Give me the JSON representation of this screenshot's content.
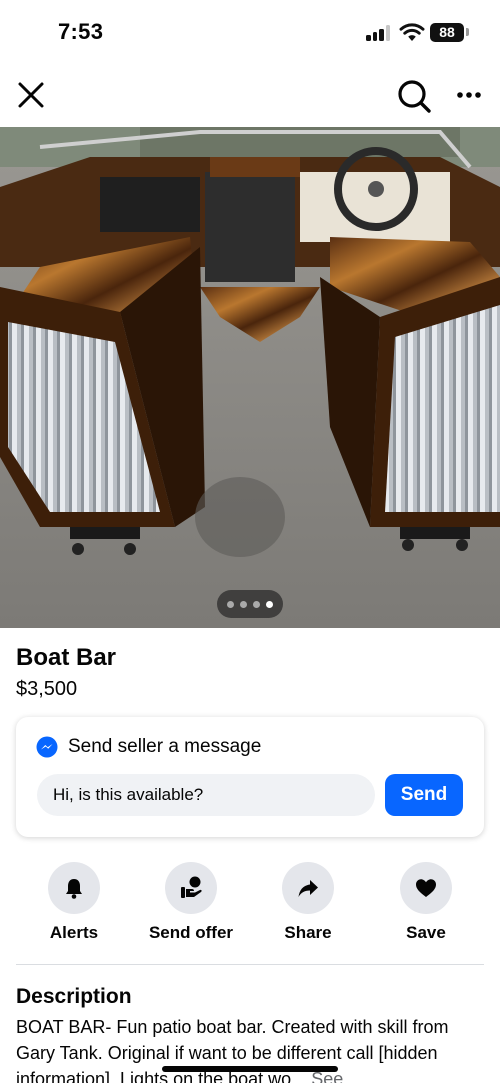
{
  "status_bar": {
    "time": "7:53",
    "battery": "88"
  },
  "nav": {
    "close_icon": "close-icon",
    "search_icon": "search-icon",
    "more_icon": "more-icon"
  },
  "listing": {
    "photo_count": 4,
    "active_photo": 4,
    "title": "Boat Bar",
    "price": "$3,500"
  },
  "message": {
    "header": "Send seller a message",
    "input_value": "Hi, is this available?",
    "send_label": "Send"
  },
  "actions": [
    {
      "label": "Alerts",
      "icon": "bell-icon"
    },
    {
      "label": "Send offer",
      "icon": "offer-icon"
    },
    {
      "label": "Share",
      "icon": "share-icon"
    },
    {
      "label": "Save",
      "icon": "heart-icon"
    }
  ],
  "description": {
    "title": "Description",
    "text": "BOAT BAR- Fun patio boat bar.  Created with skill from Gary Tank. Original if want to be different call [hidden information]. Lights on the boat wo...",
    "see_more": "See"
  },
  "colors": {
    "accent": "#0866ff",
    "chip_bg": "#e4e6eb",
    "input_bg": "#f0f2f5"
  }
}
